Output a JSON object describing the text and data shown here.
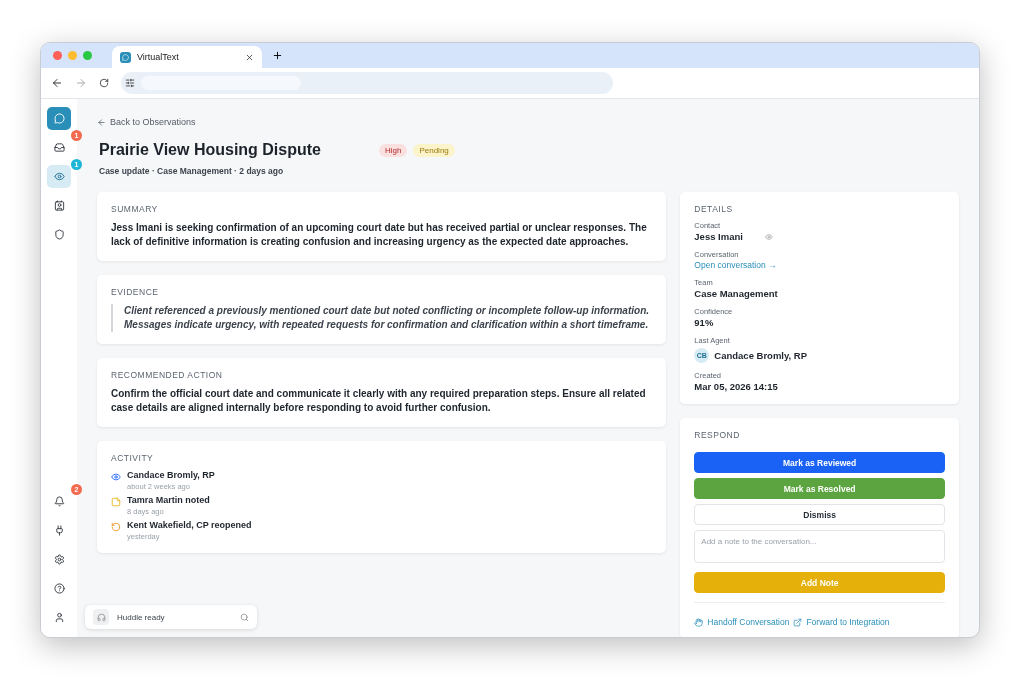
{
  "browser": {
    "tab_title": "VirtualText"
  },
  "sidebar": {
    "top": [
      {
        "kind": "inbox",
        "selected": false,
        "badge": {
          "count": "1",
          "color": "#f26b4f"
        }
      },
      {
        "kind": "eye",
        "selected": true,
        "badge": {
          "count": "1",
          "color": "#1fb5d6"
        }
      },
      {
        "kind": "contact",
        "selected": false
      },
      {
        "kind": "shield",
        "selected": false
      }
    ],
    "bottom": [
      {
        "kind": "bell",
        "selected": false,
        "badge": {
          "count": "2",
          "color": "#f26b4f"
        }
      },
      {
        "kind": "plug",
        "selected": false
      },
      {
        "kind": "gear",
        "selected": false
      },
      {
        "kind": "help",
        "selected": false
      },
      {
        "kind": "user",
        "selected": false
      }
    ]
  },
  "back_link": "Back to Observations",
  "title": "Prairie View Housing Dispute",
  "tags": [
    {
      "label": "High",
      "kind": "priority"
    },
    {
      "label": "Pending",
      "kind": "status"
    }
  ],
  "subtitle": "Case update · Case Management · 2 days ago",
  "sections": [
    {
      "kind": "text",
      "heading": "SUMMARY",
      "body": "Jess Imani is seeking confirmation of an upcoming court date but has received partial or unclear responses. The lack of definitive information is creating confusion and increasing urgency as the expected date approaches."
    },
    {
      "kind": "quote",
      "heading": "EVIDENCE",
      "body": "Client referenced a previously mentioned court date but noted conflicting or incomplete follow-up information. Messages indicate urgency, with repeated requests for confirmation and clarification within a short timeframe."
    },
    {
      "kind": "text",
      "heading": "RECOMMENDED ACTION",
      "body": "Confirm the official court date and communicate it clearly with any required preparation steps. Ensure all related case details are aligned internally before responding to avoid further confusion."
    }
  ],
  "activity": {
    "heading": "ACTIVITY",
    "items": [
      {
        "kind": "viewed",
        "title": "Candace Bromly, RP",
        "time": "about 2 weeks ago"
      },
      {
        "kind": "noted",
        "title": "Tamra Martin noted",
        "time": "8 days ago"
      },
      {
        "kind": "reopened",
        "title": "Kent Wakefield, CP reopened",
        "time": "yesterday"
      }
    ]
  },
  "huddle": {
    "label": "Huddle ready"
  },
  "details": {
    "heading": "DETAILS",
    "fields": [
      {
        "kind": "contact",
        "label": "Contact",
        "value": "Jess Imani"
      },
      {
        "kind": "link",
        "label": "Conversation",
        "value": "Open conversation →"
      },
      {
        "kind": "text",
        "label": "Team",
        "value": "Case Management"
      },
      {
        "kind": "text",
        "label": "Confidence",
        "value": "91%"
      },
      {
        "kind": "agent",
        "label": "Last Agent",
        "value": "Candace Bromly, RP",
        "initials": "CB"
      },
      {
        "kind": "text",
        "label": "Created",
        "value": "Mar 05, 2026 14:15"
      }
    ]
  },
  "respond": {
    "heading": "RESPOND",
    "buttons": [
      {
        "kind": "primary",
        "label": "Mark as Reviewed"
      },
      {
        "kind": "success",
        "label": "Mark as Resolved"
      },
      {
        "kind": "outline",
        "label": "Dismiss"
      }
    ],
    "note_placeholder": "Add a note to the conversation...",
    "add_note": "Add Note",
    "links": [
      {
        "kind": "handoff",
        "label": "Handoff Conversation"
      },
      {
        "kind": "forward",
        "label": "Forward to Integration"
      }
    ]
  }
}
